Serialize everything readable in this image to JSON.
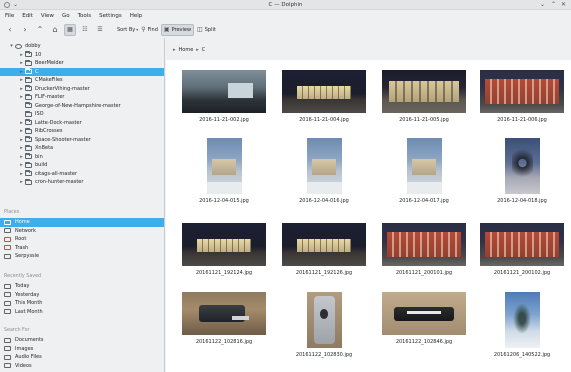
{
  "window": {
    "title": "C — Dolphin"
  },
  "menu": [
    "File",
    "Edit",
    "View",
    "Go",
    "Tools",
    "Settings",
    "Help"
  ],
  "toolbar": {
    "sort_label": "Sort By",
    "find_label": "Find",
    "preview_label": "Preview",
    "split_label": "Split"
  },
  "breadcrumb": [
    "Home",
    "C"
  ],
  "folder_tree": [
    {
      "label": "dobby",
      "level": 0,
      "arrow": "▾",
      "kind": "disk"
    },
    {
      "label": "10",
      "level": 1,
      "arrow": "▸",
      "kind": "folder"
    },
    {
      "label": "BeerMelder",
      "level": 1,
      "arrow": "▸",
      "kind": "folder"
    },
    {
      "label": "C",
      "level": 1,
      "arrow": "▸",
      "kind": "folder",
      "selected": true
    },
    {
      "label": "CMakeFiles",
      "level": 1,
      "arrow": "▸",
      "kind": "folder"
    },
    {
      "label": "DruckerVihing-master",
      "level": 1,
      "arrow": "▸",
      "kind": "folder"
    },
    {
      "label": "FLIF-master",
      "level": 1,
      "arrow": "▸",
      "kind": "folder"
    },
    {
      "label": "George-of-New-Hampshire-master",
      "level": 1,
      "arrow": "",
      "kind": "folder"
    },
    {
      "label": "ISO",
      "level": 1,
      "arrow": "",
      "kind": "folder"
    },
    {
      "label": "Latte-Dock-master",
      "level": 1,
      "arrow": "▸",
      "kind": "folder"
    },
    {
      "label": "RibCrosses",
      "level": 1,
      "arrow": "▸",
      "kind": "folder"
    },
    {
      "label": "Space-Shooter-master",
      "level": 1,
      "arrow": "▸",
      "kind": "folder"
    },
    {
      "label": "XnBeta",
      "level": 1,
      "arrow": "▸",
      "kind": "folder"
    },
    {
      "label": "bin",
      "level": 1,
      "arrow": "▸",
      "kind": "folder"
    },
    {
      "label": "build",
      "level": 1,
      "arrow": "▸",
      "kind": "folder"
    },
    {
      "label": "citags-all-master",
      "level": 1,
      "arrow": "▸",
      "kind": "folder"
    },
    {
      "label": "cron-hunter-master",
      "level": 1,
      "arrow": "▸",
      "kind": "folder"
    }
  ],
  "places": {
    "title": "Places",
    "items": [
      {
        "label": "Home",
        "icon": "home-icon",
        "selected": true
      },
      {
        "label": "Network",
        "icon": "network-icon"
      },
      {
        "label": "Root",
        "icon": "root-folder-icon"
      },
      {
        "label": "Trash",
        "icon": "trash-icon"
      },
      {
        "label": "Serpyssie",
        "icon": "user-icon"
      }
    ]
  },
  "recently_saved": {
    "title": "Recently Saved",
    "items": [
      {
        "label": "Today",
        "icon": "calendar-icon"
      },
      {
        "label": "Yesterday",
        "icon": "calendar-icon"
      },
      {
        "label": "This Month",
        "icon": "calendar-icon"
      },
      {
        "label": "Last Month",
        "icon": "calendar-icon"
      }
    ]
  },
  "search_for": {
    "title": "Search For",
    "items": [
      {
        "label": "Documents",
        "icon": "document-icon"
      },
      {
        "label": "Images",
        "icon": "image-icon"
      },
      {
        "label": "Audio Files",
        "icon": "audio-icon"
      },
      {
        "label": "Videos",
        "icon": "video-icon"
      }
    ]
  },
  "files": [
    {
      "name": "2016-11-21-002.jpg",
      "orient": "land",
      "style": "office"
    },
    {
      "name": "2016-11-21-004.jpg",
      "orient": "land",
      "style": "night"
    },
    {
      "name": "2016-11-21-005.jpg",
      "orient": "land",
      "style": "nightclose"
    },
    {
      "name": "2016-11-21-006.jpg",
      "orient": "land",
      "style": "redbldg"
    },
    {
      "name": "2016-12-04-015.jpg",
      "orient": "port",
      "style": "snow"
    },
    {
      "name": "2016-12-04-016.jpg",
      "orient": "port",
      "style": "snow"
    },
    {
      "name": "2016-12-04-017.jpg",
      "orient": "port",
      "style": "snow"
    },
    {
      "name": "2016-12-04-018.jpg",
      "orient": "port",
      "style": "tree-img"
    },
    {
      "name": "20161121_192124.jpg",
      "orient": "land",
      "style": "night"
    },
    {
      "name": "20161121_192126.jpg",
      "orient": "land",
      "style": "night"
    },
    {
      "name": "20161121_200101.jpg",
      "orient": "land",
      "style": "redbldg"
    },
    {
      "name": "20161121_200102.jpg",
      "orient": "land",
      "style": "redbldg"
    },
    {
      "name": "20161122_102816.jpg",
      "orient": "land",
      "style": "desk"
    },
    {
      "name": "20161122_102830.jpg",
      "orient": "port",
      "style": "phone"
    },
    {
      "name": "20161122_102846.jpg",
      "orient": "land",
      "style": "phoneblack"
    },
    {
      "name": "20161206_140522.jpg",
      "orient": "port",
      "style": "snowtree"
    }
  ]
}
